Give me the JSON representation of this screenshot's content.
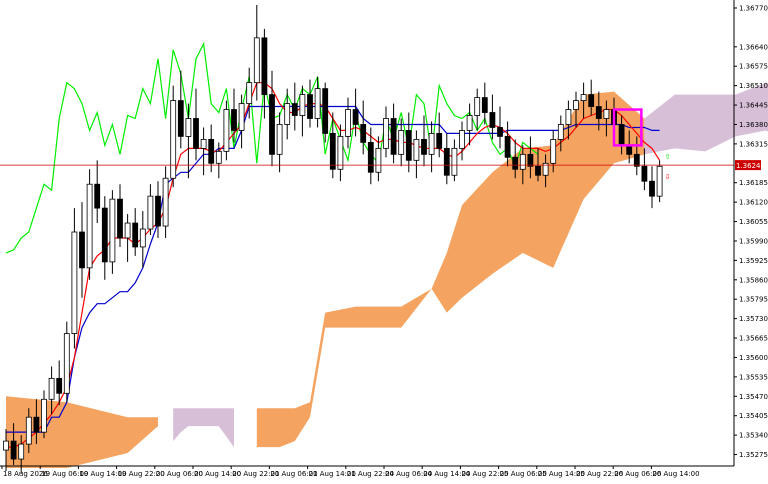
{
  "chart_data": {
    "type": "candlestick",
    "indicator": "Ichimoku Kinko Hyo",
    "x_tick_labels": [
      "18 Aug 2026",
      "19 Aug 06:00",
      "19 Aug 14:00",
      "19 Aug 22:00",
      "20 Aug 06:00",
      "20 Aug 14:00",
      "20 Aug 22:00",
      "21 Aug 06:00",
      "21 Aug 14:00",
      "21 Aug 22:00",
      "24 Aug 06:00",
      "24 Aug 14:00",
      "24 Aug 22:00",
      "25 Aug 06:00",
      "25 Aug 14:00",
      "25 Aug 22:00",
      "26 Aug 06:00",
      "26 Aug 14:00"
    ],
    "y_tick_labels": [
      "1.36770",
      "1.36640",
      "1.36575",
      "1.36510",
      "1.36445",
      "1.36380",
      "1.36315",
      "1.36185",
      "1.36120",
      "1.36055",
      "1.35990",
      "1.35925",
      "1.35860",
      "1.35795",
      "1.35730",
      "1.35665",
      "1.35600",
      "1.35535",
      "1.35470",
      "1.35405",
      "1.35340",
      "1.35275"
    ],
    "ylim": [
      1.3524,
      1.3679
    ],
    "current_price": 1.36244,
    "current_price_label": "1.36244",
    "colors": {
      "background": "#ffffff",
      "candle": "#000000",
      "tenkan_sen": "#ff0000",
      "kijun_sen": "#0000cc",
      "chikou_span": "#00ee00",
      "kumo_bullish": "#f4a460",
      "kumo_bearish": "#d8bfd8",
      "price_line": "#cc0000",
      "highlight_box": "#ff00ff",
      "arrow_up": "#00cc00",
      "arrow_down": "#ff0000"
    },
    "candles": [
      {
        "o": 1.3529,
        "h": 1.3536,
        "l": 1.3522,
        "c": 1.3532
      },
      {
        "o": 1.3532,
        "h": 1.3538,
        "l": 1.3524,
        "c": 1.3526
      },
      {
        "o": 1.3526,
        "h": 1.3534,
        "l": 1.3521,
        "c": 1.3531
      },
      {
        "o": 1.3531,
        "h": 1.3543,
        "l": 1.3528,
        "c": 1.354
      },
      {
        "o": 1.354,
        "h": 1.3546,
        "l": 1.3531,
        "c": 1.3535
      },
      {
        "o": 1.3535,
        "h": 1.3549,
        "l": 1.3533,
        "c": 1.3546
      },
      {
        "o": 1.3546,
        "h": 1.3557,
        "l": 1.3541,
        "c": 1.3553
      },
      {
        "o": 1.3553,
        "h": 1.3559,
        "l": 1.3544,
        "c": 1.3548
      },
      {
        "o": 1.3548,
        "h": 1.3572,
        "l": 1.3545,
        "c": 1.3568
      },
      {
        "o": 1.3568,
        "h": 1.361,
        "l": 1.3563,
        "c": 1.3602
      },
      {
        "o": 1.3602,
        "h": 1.3612,
        "l": 1.358,
        "c": 1.359
      },
      {
        "o": 1.359,
        "h": 1.3623,
        "l": 1.3586,
        "c": 1.3618
      },
      {
        "o": 1.3618,
        "h": 1.3626,
        "l": 1.3605,
        "c": 1.361
      },
      {
        "o": 1.361,
        "h": 1.3614,
        "l": 1.3586,
        "c": 1.3592
      },
      {
        "o": 1.3592,
        "h": 1.3616,
        "l": 1.3588,
        "c": 1.3613
      },
      {
        "o": 1.3613,
        "h": 1.3618,
        "l": 1.3597,
        "c": 1.36
      },
      {
        "o": 1.36,
        "h": 1.3608,
        "l": 1.3592,
        "c": 1.3605
      },
      {
        "o": 1.3605,
        "h": 1.361,
        "l": 1.3594,
        "c": 1.3597
      },
      {
        "o": 1.3597,
        "h": 1.3609,
        "l": 1.359,
        "c": 1.3603
      },
      {
        "o": 1.3603,
        "h": 1.3618,
        "l": 1.3601,
        "c": 1.3614
      },
      {
        "o": 1.3614,
        "h": 1.3619,
        "l": 1.36,
        "c": 1.3604
      },
      {
        "o": 1.3604,
        "h": 1.3624,
        "l": 1.36,
        "c": 1.362
      },
      {
        "o": 1.362,
        "h": 1.3651,
        "l": 1.3617,
        "c": 1.3646
      },
      {
        "o": 1.3646,
        "h": 1.3656,
        "l": 1.363,
        "c": 1.3634
      },
      {
        "o": 1.3634,
        "h": 1.3645,
        "l": 1.362,
        "c": 1.364
      },
      {
        "o": 1.364,
        "h": 1.365,
        "l": 1.3626,
        "c": 1.363
      },
      {
        "o": 1.363,
        "h": 1.3637,
        "l": 1.3621,
        "c": 1.3633
      },
      {
        "o": 1.3633,
        "h": 1.3638,
        "l": 1.3622,
        "c": 1.3625
      },
      {
        "o": 1.3625,
        "h": 1.3632,
        "l": 1.362,
        "c": 1.3629
      },
      {
        "o": 1.3629,
        "h": 1.3646,
        "l": 1.3626,
        "c": 1.3643
      },
      {
        "o": 1.3643,
        "h": 1.365,
        "l": 1.3632,
        "c": 1.3636
      },
      {
        "o": 1.3636,
        "h": 1.3648,
        "l": 1.363,
        "c": 1.3645
      },
      {
        "o": 1.3645,
        "h": 1.3657,
        "l": 1.364,
        "c": 1.3652
      },
      {
        "o": 1.3652,
        "h": 1.3678,
        "l": 1.3646,
        "c": 1.3667
      },
      {
        "o": 1.3667,
        "h": 1.367,
        "l": 1.364,
        "c": 1.3648
      },
      {
        "o": 1.3648,
        "h": 1.3656,
        "l": 1.3624,
        "c": 1.3628
      },
      {
        "o": 1.3628,
        "h": 1.3642,
        "l": 1.3622,
        "c": 1.3638
      },
      {
        "o": 1.3638,
        "h": 1.365,
        "l": 1.3633,
        "c": 1.3645
      },
      {
        "o": 1.3645,
        "h": 1.3652,
        "l": 1.3636,
        "c": 1.3641
      },
      {
        "o": 1.3641,
        "h": 1.3651,
        "l": 1.3634,
        "c": 1.3648
      },
      {
        "o": 1.3648,
        "h": 1.3653,
        "l": 1.3637,
        "c": 1.364
      },
      {
        "o": 1.364,
        "h": 1.3654,
        "l": 1.3637,
        "c": 1.365
      },
      {
        "o": 1.365,
        "h": 1.3652,
        "l": 1.3632,
        "c": 1.3635
      },
      {
        "o": 1.3635,
        "h": 1.3642,
        "l": 1.362,
        "c": 1.3623
      },
      {
        "o": 1.3623,
        "h": 1.3638,
        "l": 1.3619,
        "c": 1.3634
      },
      {
        "o": 1.3634,
        "h": 1.3647,
        "l": 1.363,
        "c": 1.3643
      },
      {
        "o": 1.3643,
        "h": 1.365,
        "l": 1.3634,
        "c": 1.3638
      },
      {
        "o": 1.3638,
        "h": 1.3646,
        "l": 1.3628,
        "c": 1.3632
      },
      {
        "o": 1.3632,
        "h": 1.3637,
        "l": 1.3618,
        "c": 1.3622
      },
      {
        "o": 1.3622,
        "h": 1.3634,
        "l": 1.3619,
        "c": 1.363
      },
      {
        "o": 1.363,
        "h": 1.3644,
        "l": 1.3627,
        "c": 1.364
      },
      {
        "o": 1.364,
        "h": 1.3645,
        "l": 1.3625,
        "c": 1.3628
      },
      {
        "o": 1.3628,
        "h": 1.364,
        "l": 1.3624,
        "c": 1.3636
      },
      {
        "o": 1.3636,
        "h": 1.3642,
        "l": 1.3622,
        "c": 1.3626
      },
      {
        "o": 1.3626,
        "h": 1.3636,
        "l": 1.362,
        "c": 1.3633
      },
      {
        "o": 1.3633,
        "h": 1.3641,
        "l": 1.3624,
        "c": 1.3628
      },
      {
        "o": 1.3628,
        "h": 1.3639,
        "l": 1.3622,
        "c": 1.3635
      },
      {
        "o": 1.3635,
        "h": 1.3642,
        "l": 1.3627,
        "c": 1.363
      },
      {
        "o": 1.363,
        "h": 1.3635,
        "l": 1.3618,
        "c": 1.3621
      },
      {
        "o": 1.3621,
        "h": 1.3633,
        "l": 1.3619,
        "c": 1.363
      },
      {
        "o": 1.363,
        "h": 1.3639,
        "l": 1.3626,
        "c": 1.3636
      },
      {
        "o": 1.3636,
        "h": 1.3645,
        "l": 1.3631,
        "c": 1.3641
      },
      {
        "o": 1.3641,
        "h": 1.365,
        "l": 1.3636,
        "c": 1.3647
      },
      {
        "o": 1.3647,
        "h": 1.3652,
        "l": 1.3638,
        "c": 1.3642
      },
      {
        "o": 1.3642,
        "h": 1.3648,
        "l": 1.3633,
        "c": 1.3637
      },
      {
        "o": 1.3637,
        "h": 1.3644,
        "l": 1.363,
        "c": 1.3634
      },
      {
        "o": 1.3634,
        "h": 1.3639,
        "l": 1.3624,
        "c": 1.3627
      },
      {
        "o": 1.3627,
        "h": 1.3633,
        "l": 1.362,
        "c": 1.3623
      },
      {
        "o": 1.3623,
        "h": 1.3631,
        "l": 1.3618,
        "c": 1.3628
      },
      {
        "o": 1.3628,
        "h": 1.3634,
        "l": 1.362,
        "c": 1.3624
      },
      {
        "o": 1.3624,
        "h": 1.363,
        "l": 1.3619,
        "c": 1.3621
      },
      {
        "o": 1.3621,
        "h": 1.3628,
        "l": 1.3617,
        "c": 1.3625
      },
      {
        "o": 1.3625,
        "h": 1.3636,
        "l": 1.3622,
        "c": 1.3633
      },
      {
        "o": 1.3633,
        "h": 1.3641,
        "l": 1.3629,
        "c": 1.3638
      },
      {
        "o": 1.3638,
        "h": 1.3646,
        "l": 1.3633,
        "c": 1.3643
      },
      {
        "o": 1.3643,
        "h": 1.3649,
        "l": 1.3637,
        "c": 1.3646
      },
      {
        "o": 1.3646,
        "h": 1.3652,
        "l": 1.364,
        "c": 1.3648
      },
      {
        "o": 1.3648,
        "h": 1.3653,
        "l": 1.3641,
        "c": 1.3644
      },
      {
        "o": 1.3644,
        "h": 1.3649,
        "l": 1.3636,
        "c": 1.364
      },
      {
        "o": 1.364,
        "h": 1.3646,
        "l": 1.3634,
        "c": 1.3643
      },
      {
        "o": 1.3643,
        "h": 1.3647,
        "l": 1.3636,
        "c": 1.3638
      },
      {
        "o": 1.3638,
        "h": 1.3641,
        "l": 1.3628,
        "c": 1.3631
      },
      {
        "o": 1.3631,
        "h": 1.3636,
        "l": 1.3625,
        "c": 1.3628
      },
      {
        "o": 1.3628,
        "h": 1.3634,
        "l": 1.3621,
        "c": 1.3624
      },
      {
        "o": 1.3624,
        "h": 1.363,
        "l": 1.3616,
        "c": 1.3619
      },
      {
        "o": 1.3619,
        "h": 1.3624,
        "l": 1.361,
        "c": 1.3614
      },
      {
        "o": 1.3614,
        "h": 1.3626,
        "l": 1.3612,
        "c": 1.3624
      }
    ],
    "tenkan_sen": [
      1.353,
      1.353,
      1.3531,
      1.3533,
      1.3535,
      1.3538,
      1.3541,
      1.3545,
      1.355,
      1.356,
      1.3575,
      1.359,
      1.3594,
      1.3596,
      1.36,
      1.36,
      1.36,
      1.3598,
      1.36,
      1.3603,
      1.3605,
      1.361,
      1.362,
      1.3628,
      1.363,
      1.363,
      1.363,
      1.3629,
      1.3629,
      1.3632,
      1.3635,
      1.3638,
      1.3645,
      1.3652,
      1.3652,
      1.365,
      1.3645,
      1.3642,
      1.3642,
      1.3644,
      1.3645,
      1.3645,
      1.3644,
      1.364,
      1.3636,
      1.3636,
      1.3637,
      1.3636,
      1.3634,
      1.3632,
      1.3633,
      1.3633,
      1.3632,
      1.3632,
      1.3631,
      1.363,
      1.363,
      1.363,
      1.3628,
      1.3627,
      1.3629,
      1.3632,
      1.3635,
      1.3637,
      1.3638,
      1.3637,
      1.3635,
      1.3632,
      1.363,
      1.363,
      1.363,
      1.3629,
      1.363,
      1.3632,
      1.3634,
      1.3637,
      1.364,
      1.3641,
      1.3642,
      1.3643,
      1.3643,
      1.3641,
      1.3638,
      1.3635,
      1.3632,
      1.363,
      1.3626
    ],
    "kijun_sen": [
      1.3535,
      1.3535,
      1.3535,
      1.3535,
      1.3535,
      1.3535,
      1.354,
      1.354,
      1.3545,
      1.356,
      1.357,
      1.3575,
      1.3578,
      1.3578,
      1.358,
      1.3582,
      1.3582,
      1.3585,
      1.359,
      1.3598,
      1.3605,
      1.3618,
      1.362,
      1.3622,
      1.3622,
      1.3625,
      1.3628,
      1.3628,
      1.363,
      1.363,
      1.363,
      1.3636,
      1.3644,
      1.3644,
      1.3644,
      1.3644,
      1.3644,
      1.3644,
      1.3644,
      1.3644,
      1.3644,
      1.3644,
      1.3644,
      1.3644,
      1.3644,
      1.3644,
      1.3644,
      1.364,
      1.3638,
      1.3638,
      1.3638,
      1.3638,
      1.3638,
      1.3638,
      1.3638,
      1.3638,
      1.3638,
      1.3638,
      1.3635,
      1.3635,
      1.3635,
      1.3635,
      1.3635,
      1.3635,
      1.3635,
      1.3635,
      1.3636,
      1.3636,
      1.3636,
      1.3636,
      1.3636,
      1.3636,
      1.3636,
      1.3636,
      1.3637,
      1.3638,
      1.3638,
      1.3638,
      1.3638,
      1.3638,
      1.3638,
      1.3638,
      1.3637,
      1.3637,
      1.3637,
      1.3636,
      1.3636
    ],
    "chikou_span": [
      1.3595,
      1.3596,
      1.36,
      1.3602,
      1.361,
      1.3618,
      1.3616,
      1.364,
      1.3652,
      1.365,
      1.3645,
      1.3636,
      1.3642,
      1.3631,
      1.3638,
      1.3628,
      1.3641,
      1.364,
      1.365,
      1.3645,
      1.366,
      1.364,
      1.3663,
      1.3655,
      1.364,
      1.366,
      1.3665,
      1.3645,
      1.3642,
      1.365,
      1.363,
      1.3643,
      1.3654,
      1.3625,
      1.3652,
      1.364,
      1.3641,
      1.3648,
      1.3643,
      1.365,
      1.3648,
      1.3654,
      1.3628,
      1.364,
      1.3633,
      1.3626,
      1.3642,
      1.3632,
      1.3628,
      1.3625,
      1.364,
      1.3633,
      1.3642,
      1.363,
      1.3648,
      1.3645,
      1.3628,
      1.3651,
      1.3645,
      1.3641,
      1.364,
      1.3642,
      1.3636,
      1.364,
      1.3632,
      1.3628,
      1.363,
      1.3624,
      1.3632,
      1.363,
      1.3628
    ],
    "senkou_span_a": [
      1.3547,
      1.3545,
      1.354,
      1.354,
      1.3538,
      1.3535,
      1.3532,
      1.353,
      1.3528,
      1.3526,
      1.3528,
      1.353,
      1.3532,
      1.3532,
      1.3532,
      1.3532,
      1.3532,
      1.3532,
      1.3532,
      1.3532,
      1.3532,
      1.3532,
      1.3532,
      1.3532,
      1.3532,
      1.3532,
      1.3532,
      1.3532,
      1.3532,
      1.3532,
      1.3532,
      1.3532,
      1.3532,
      1.3532,
      1.3532,
      1.3532,
      1.3532,
      1.3532,
      1.3532,
      1.3532,
      1.3532,
      1.3532,
      1.3532,
      1.3532,
      1.3532,
      1.3532,
      1.3532,
      1.3532,
      1.3532,
      1.3532,
      1.3532,
      1.3532,
      1.3532,
      1.3532,
      1.3532,
      1.3532,
      1.3532,
      1.3532,
      1.3532,
      1.3532,
      1.3532,
      1.3532,
      1.3532,
      1.3532,
      1.3532,
      1.3532,
      1.3532,
      1.3532,
      1.3532,
      1.3532,
      1.3532,
      1.3532,
      1.3532,
      1.3532,
      1.3532,
      1.3532,
      1.3532,
      1.3532,
      1.3532,
      1.3532,
      1.3532,
      1.3532,
      1.3532,
      1.3532,
      1.3532,
      1.3532,
      1.3532,
      1.3532,
      1.3532,
      1.3532,
      1.3532,
      1.3532,
      1.3532,
      1.3532,
      1.3532,
      1.3532,
      1.3532,
      1.3532,
      1.3532,
      1.3532,
      1.3532,
      1.3532,
      1.3532,
      1.3532,
      1.3532,
      1.3532,
      1.3532,
      1.3532,
      1.3532,
      1.3532,
      1.3532
    ],
    "kumo": {
      "upper": [
        [
          0,
          1.3547
        ],
        [
          8,
          1.3545
        ],
        [
          16,
          1.354
        ],
        [
          20,
          1.354
        ],
        [
          22,
          1.3543
        ],
        [
          23,
          1.3543
        ],
        [
          24,
          1.3543
        ],
        [
          28,
          1.3543
        ],
        [
          30,
          1.3543
        ],
        [
          33,
          1.3543
        ],
        [
          36,
          1.3543
        ],
        [
          38,
          1.3543
        ],
        [
          40,
          1.3545
        ],
        [
          42,
          1.3575
        ],
        [
          46,
          1.3577
        ],
        [
          52,
          1.3577
        ],
        [
          56,
          1.3583
        ],
        [
          58,
          1.3595
        ],
        [
          60,
          1.3611
        ],
        [
          64,
          1.3622
        ],
        [
          68,
          1.363
        ],
        [
          72,
          1.3631
        ],
        [
          76,
          1.3648
        ],
        [
          80,
          1.3649
        ],
        [
          84,
          1.364
        ],
        [
          88,
          1.3648
        ],
        [
          92,
          1.3648
        ],
        [
          96,
          1.3648
        ],
        [
          100,
          1.3652
        ],
        [
          104,
          1.365
        ],
        [
          108,
          1.3645
        ],
        [
          110,
          1.364
        ],
        [
          112,
          1.364
        ],
        [
          114,
          1.3641
        ],
        [
          116,
          1.364
        ]
      ],
      "lower": [
        [
          0,
          1.3523
        ],
        [
          8,
          1.3523
        ],
        [
          16,
          1.3528
        ],
        [
          20,
          1.3537
        ],
        [
          22,
          1.3532
        ],
        [
          23,
          1.3535
        ],
        [
          24,
          1.3537
        ],
        [
          28,
          1.3537
        ],
        [
          30,
          1.353
        ],
        [
          33,
          1.353
        ],
        [
          36,
          1.353
        ],
        [
          38,
          1.3532
        ],
        [
          40,
          1.354
        ],
        [
          42,
          1.357
        ],
        [
          46,
          1.357
        ],
        [
          52,
          1.357
        ],
        [
          56,
          1.3583
        ],
        [
          58,
          1.3575
        ],
        [
          60,
          1.358
        ],
        [
          64,
          1.3588
        ],
        [
          68,
          1.3595
        ],
        [
          72,
          1.359
        ],
        [
          76,
          1.3613
        ],
        [
          80,
          1.3625
        ],
        [
          84,
          1.3628
        ],
        [
          88,
          1.363
        ],
        [
          92,
          1.3629
        ],
        [
          96,
          1.3634
        ],
        [
          100,
          1.3636
        ],
        [
          104,
          1.363
        ],
        [
          108,
          1.363
        ],
        [
          110,
          1.364
        ],
        [
          112,
          1.3638
        ],
        [
          114,
          1.3637
        ],
        [
          116,
          1.3638
        ]
      ],
      "bearish_segments": [
        [
          21,
          32
        ],
        [
          84,
          112
        ]
      ]
    },
    "signals": {
      "up_arrow": "⇧",
      "down_arrow": "⇩"
    }
  }
}
